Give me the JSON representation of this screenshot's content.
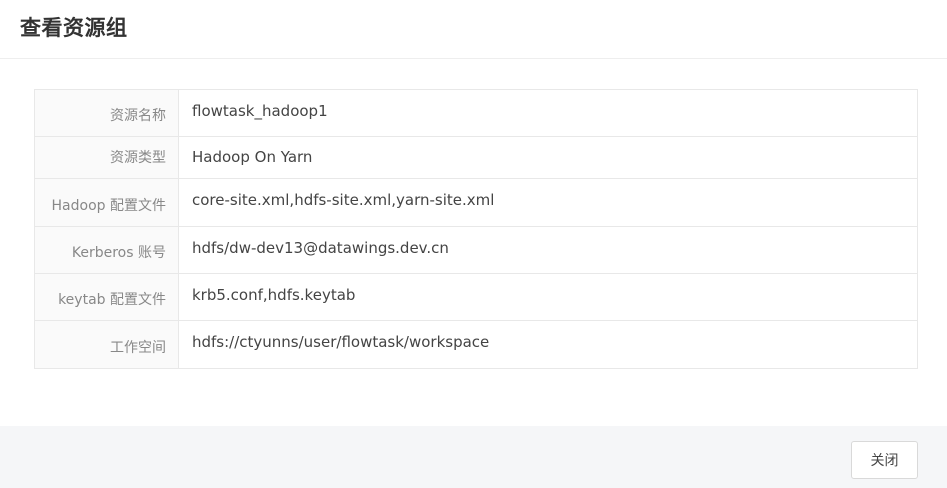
{
  "dialog": {
    "title": "查看资源组",
    "close_label": "关闭"
  },
  "details": [
    {
      "label": "资源名称",
      "value": "flowtask_hadoop1"
    },
    {
      "label": "资源类型",
      "value": "Hadoop On Yarn"
    },
    {
      "label": "Hadoop 配置文件",
      "value": "core-site.xml,hdfs-site.xml,yarn-site.xml"
    },
    {
      "label": "Kerberos 账号",
      "value": "hdfs/dw-dev13@datawings.dev.cn"
    },
    {
      "label": "keytab 配置文件",
      "value": "krb5.conf,hdfs.keytab"
    },
    {
      "label": "工作空间",
      "value": "hdfs://ctyunns/user/flowtask/workspace"
    }
  ]
}
